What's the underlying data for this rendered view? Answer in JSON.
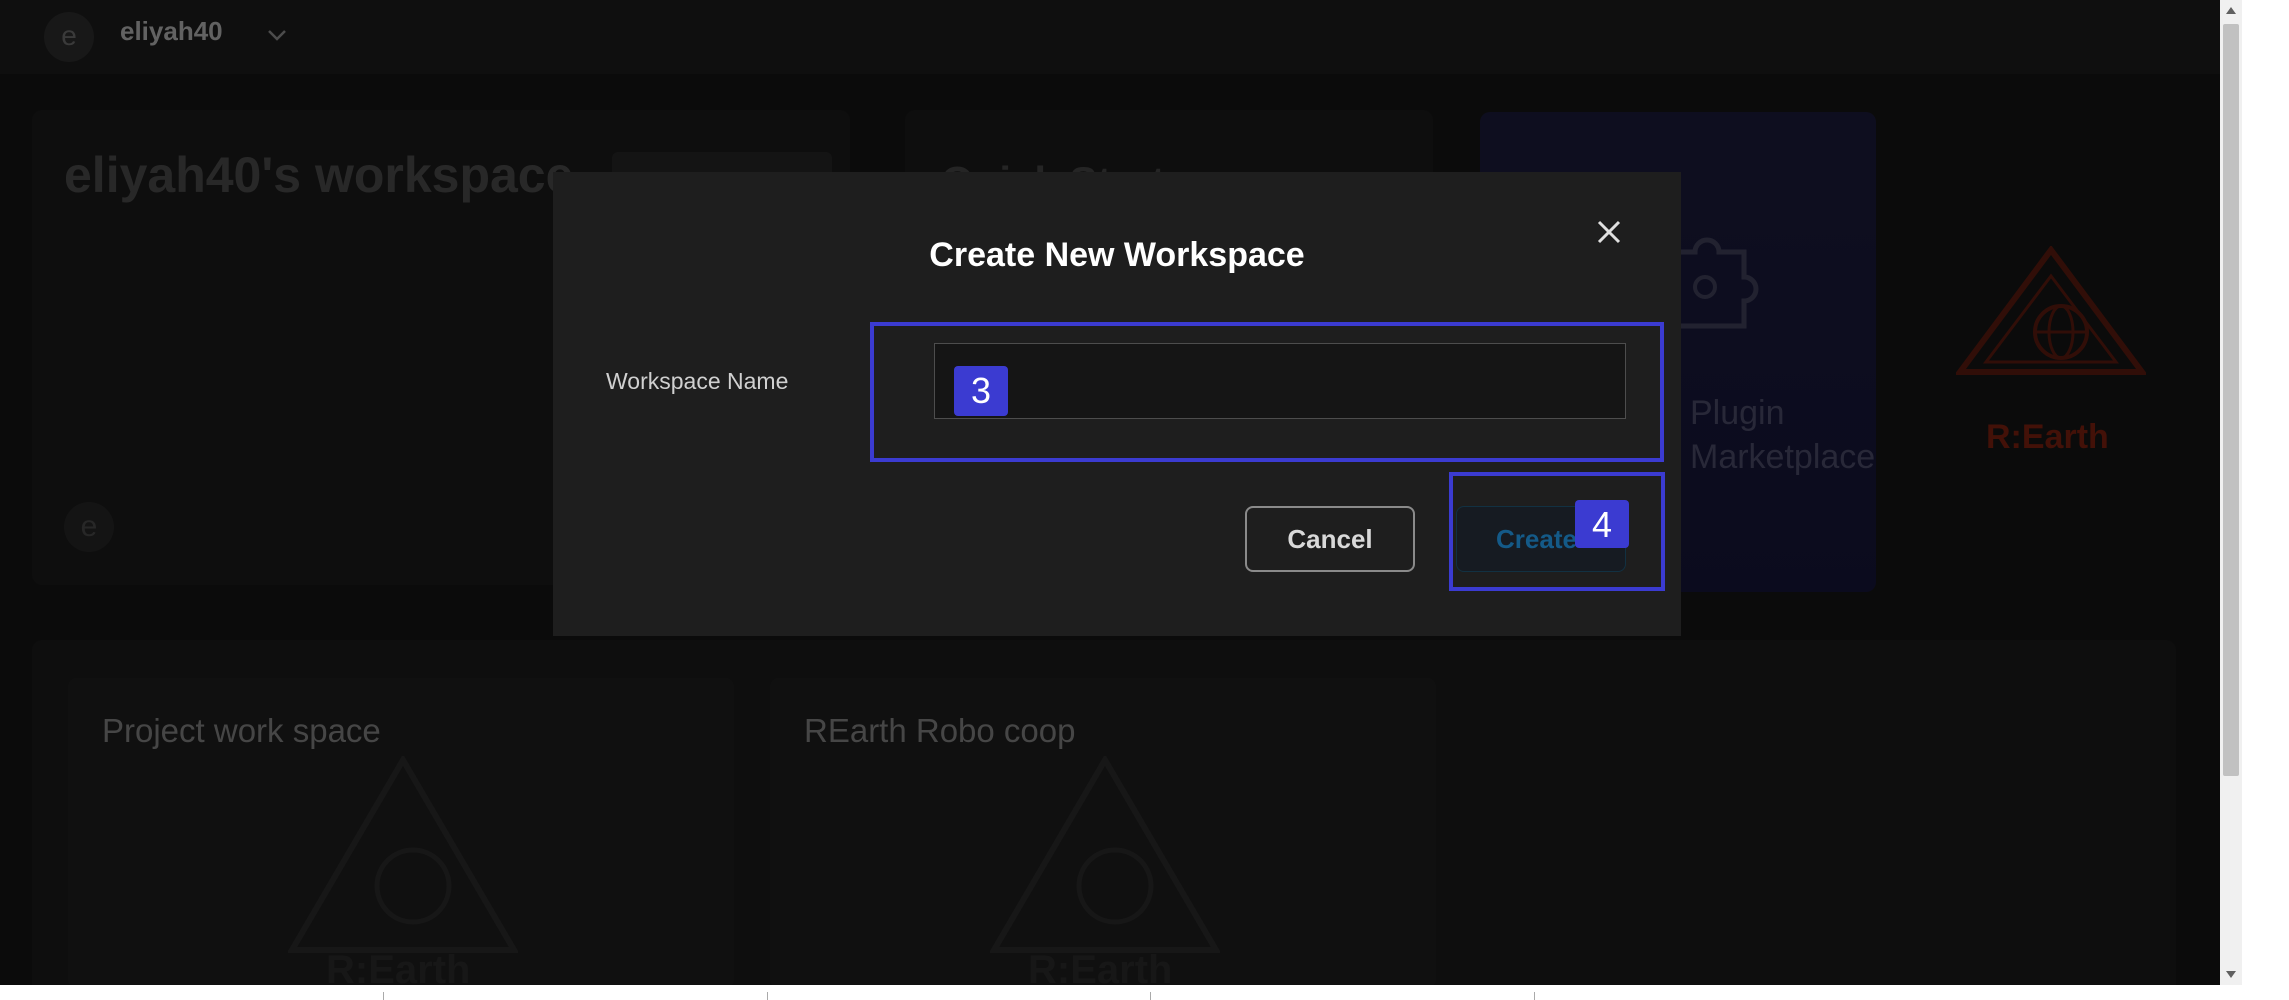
{
  "topbar": {
    "avatar_letter": "e",
    "username": "eliyah40"
  },
  "background": {
    "workspace_title": "eliyah40's workspace",
    "workspace_avatar_letter": "e",
    "quick_start_title": "Quick Start",
    "marketplace": {
      "line1": "Plugin",
      "line2": "Marketplace"
    },
    "brand_logo_text": "R:Earth",
    "projects": [
      {
        "title": "Project work space",
        "logo_text": "R:Earth"
      },
      {
        "title": "REarth Robo coop",
        "logo_text": "R:Earth"
      }
    ]
  },
  "modal": {
    "title": "Create New Workspace",
    "field_label": "Workspace Name",
    "input_value": "",
    "cancel_label": "Cancel",
    "create_label": "Create"
  },
  "annotations": {
    "input_tag": "3",
    "create_tag": "4",
    "highlight_color": "#3b3bd1"
  },
  "colors": {
    "app_bg": "#141414",
    "modal_bg": "#1e1e1e",
    "accent": "#3b3bd1",
    "brand_red": "#7a1f10"
  }
}
